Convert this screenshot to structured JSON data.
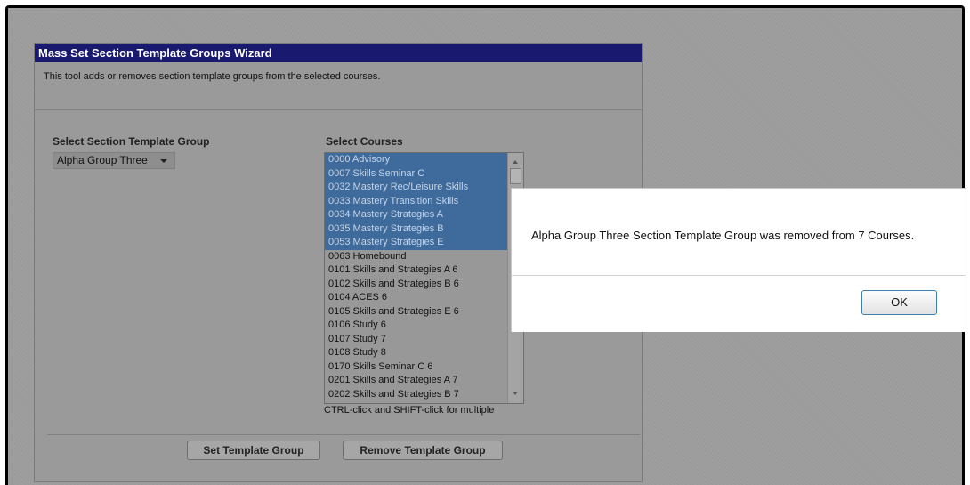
{
  "wizard": {
    "title": "Mass Set Section Template Groups Wizard",
    "description": "This tool adds or removes section template groups from the selected courses.",
    "template_group_label": "Select Section Template Group",
    "template_group_value": "Alpha Group Three",
    "courses_label": "Select Courses",
    "courses": [
      {
        "label": "0000 Advisory",
        "selected": true
      },
      {
        "label": "0007 Skills Seminar C",
        "selected": true
      },
      {
        "label": "0032 Mastery Rec/Leisure Skills",
        "selected": true
      },
      {
        "label": "0033 Mastery Transition Skills",
        "selected": true
      },
      {
        "label": "0034 Mastery Strategies A",
        "selected": true
      },
      {
        "label": "0035 Mastery Strategies B",
        "selected": true
      },
      {
        "label": "0053 Mastery Strategies E",
        "selected": true
      },
      {
        "label": "0063 Homebound",
        "selected": false
      },
      {
        "label": "0101 Skills and Strategies A 6",
        "selected": false
      },
      {
        "label": "0102 Skills and Strategies B 6",
        "selected": false
      },
      {
        "label": "0104 ACES 6",
        "selected": false
      },
      {
        "label": "0105 Skills and Strategies E 6",
        "selected": false
      },
      {
        "label": "0106 Study 6",
        "selected": false
      },
      {
        "label": "0107 Study 7",
        "selected": false
      },
      {
        "label": "0108 Study 8",
        "selected": false
      },
      {
        "label": "0170 Skills Seminar C 6",
        "selected": false
      },
      {
        "label": "0201 Skills and Strategies A 7",
        "selected": false
      },
      {
        "label": "0202 Skills and Strategies B 7",
        "selected": false
      }
    ],
    "hint": "CTRL-click and SHIFT-click for multiple",
    "set_button": "Set Template Group",
    "remove_button": "Remove Template Group"
  },
  "dialog": {
    "message": "Alpha Group Three Section Template Group was removed from 7 Courses.",
    "ok_button": "OK"
  },
  "colors": {
    "title_bar": "#191970",
    "selection": "#3f6a9c",
    "ok_border": "#3c7fb1"
  }
}
